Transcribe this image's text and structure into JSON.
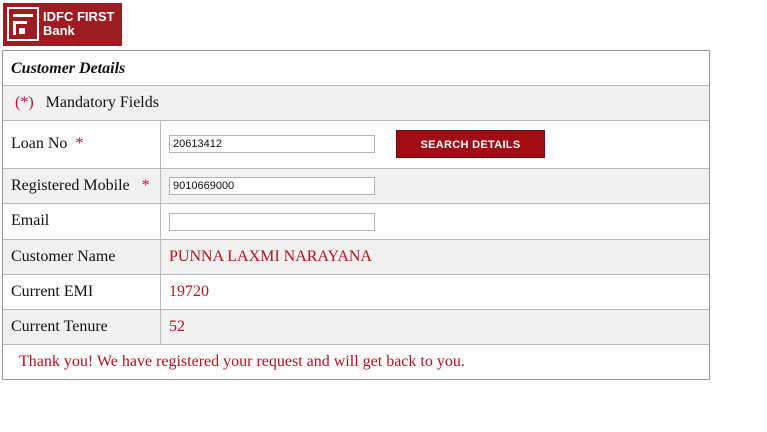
{
  "logo": {
    "line1": "IDFC FIRST",
    "line2": "Bank"
  },
  "panel": {
    "title": "Customer Details",
    "mandatory_mark": "(*)",
    "mandatory_text": "Mandatory Fields"
  },
  "fields": {
    "loan_no": {
      "label": "Loan No",
      "req": "*",
      "value": "20613412"
    },
    "mobile": {
      "label": "Registered Mobile",
      "req": "*",
      "value": "9010669000"
    },
    "email": {
      "label": "Email",
      "value": ""
    },
    "customer_name": {
      "label": "Customer Name",
      "value": "PUNNA LAXMI NARAYANA"
    },
    "current_emi": {
      "label": "Current EMI",
      "value": "19720"
    },
    "current_tenure": {
      "label": "Current Tenure",
      "value": "52"
    }
  },
  "search_button": "SEARCH DETAILS",
  "message": "Thank you! We have registered your request and will get back to you.",
  "colors": {
    "brand": "#9c1c22",
    "accent_text": "#b5121b",
    "row_alt": "#f1f1f1"
  }
}
